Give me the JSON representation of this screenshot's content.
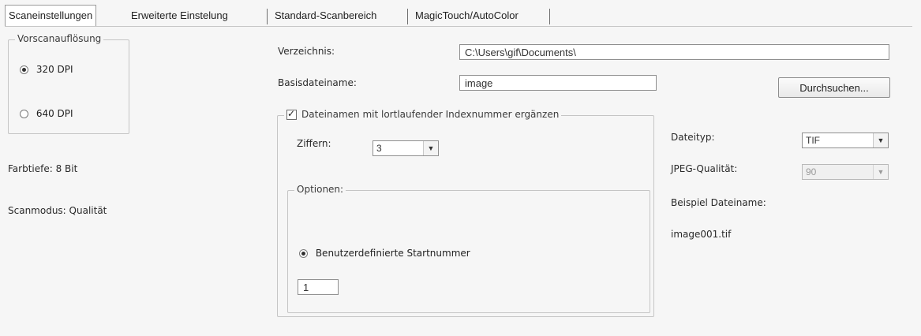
{
  "tabs": [
    {
      "label": "Scaneinstellungen",
      "active": true
    },
    {
      "label": "Erweiterte Einstelung",
      "active": false
    },
    {
      "label": "Standard-Scanbereich",
      "active": false
    },
    {
      "label": "MagicTouch/AutoColor",
      "active": false
    }
  ],
  "preview": {
    "group_label": "Vorscanauflösung",
    "options": [
      {
        "label": "320 DPI",
        "checked": true
      },
      {
        "label": "640 DPI",
        "checked": false
      }
    ]
  },
  "info": {
    "color_depth": "Farbtiefe: 8 Bit",
    "scan_mode": "Scanmodus: Qualität"
  },
  "output": {
    "directory_label": "Verzeichnis:",
    "directory_value": "C:\\Users\\gif\\Documents\\",
    "basename_label": "Basisdateiname:",
    "basename_value": "image",
    "browse_button": "Durchsuchen..."
  },
  "index": {
    "checkbox_label": "Dateinamen mit lortlaufender Indexnummer ergänzen",
    "checked": true,
    "digits_label": "Ziffern:",
    "digits_value": "3",
    "options_group_label": "Optionen:",
    "start_number_label": "Benutzerdefinierte Startnummer",
    "start_number_checked": true,
    "start_number_value": "1"
  },
  "filetype": {
    "type_label": "Dateityp:",
    "type_value": "TIF",
    "jpeg_quality_label": "JPEG-Qualität:",
    "jpeg_quality_value": "90",
    "example_label": "Beispiel Dateiname:",
    "example_value": "image001.tif"
  },
  "icons": {
    "radio": "radio-button-icon",
    "checkbox": "checkbox-icon",
    "dropdown": "dropdown-arrow-icon"
  }
}
